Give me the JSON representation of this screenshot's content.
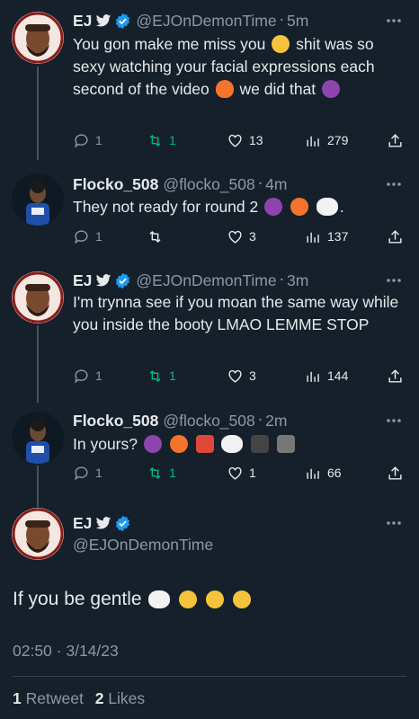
{
  "colors": {
    "background": "#15202b",
    "text": "#e7e9ea",
    "muted": "#8b98a5",
    "verified": "#1d9bf0",
    "retweet_green": "#00ba7c"
  },
  "tweets": [
    {
      "name": "EJ",
      "handle": "@EJOnDemonTime",
      "time": "5m",
      "text_parts": [
        "You gon make me miss you",
        "shit was so sexy watching your facial expressions each second of the video",
        "we did that"
      ],
      "replies": "1",
      "retweets": "1",
      "likes": "13",
      "views": "279"
    },
    {
      "name": "Flocko_508",
      "handle": "@flocko_508",
      "time": "4m",
      "text_parts": [
        "They not ready for round 2",
        "."
      ],
      "replies": "1",
      "retweets": "",
      "likes": "3",
      "views": "137"
    },
    {
      "name": "EJ",
      "handle": "@EJOnDemonTime",
      "time": "3m",
      "text_parts": [
        "I'm trynna see if you moan the same way while you inside the booty LMAO LEMME STOP"
      ],
      "replies": "1",
      "retweets": "1",
      "likes": "3",
      "views": "144"
    },
    {
      "name": "Flocko_508",
      "handle": "@flocko_508",
      "time": "2m",
      "text_parts": [
        "In yours?"
      ],
      "replies": "1",
      "retweets": "1",
      "likes": "1",
      "views": "66"
    }
  ],
  "main_tweet": {
    "name": "EJ",
    "handle": "@EJOnDemonTime",
    "text": "If you be gentle",
    "timestamp": "02:50 · 3/14/23",
    "retweet_count": "1",
    "retweet_label": "Retweet",
    "like_count": "2",
    "like_label": "Likes"
  },
  "icons": [
    "twitter-bird-icon",
    "verified-badge-icon",
    "more-icon",
    "reply-icon",
    "retweet-icon",
    "like-icon",
    "views-icon",
    "share-icon"
  ]
}
